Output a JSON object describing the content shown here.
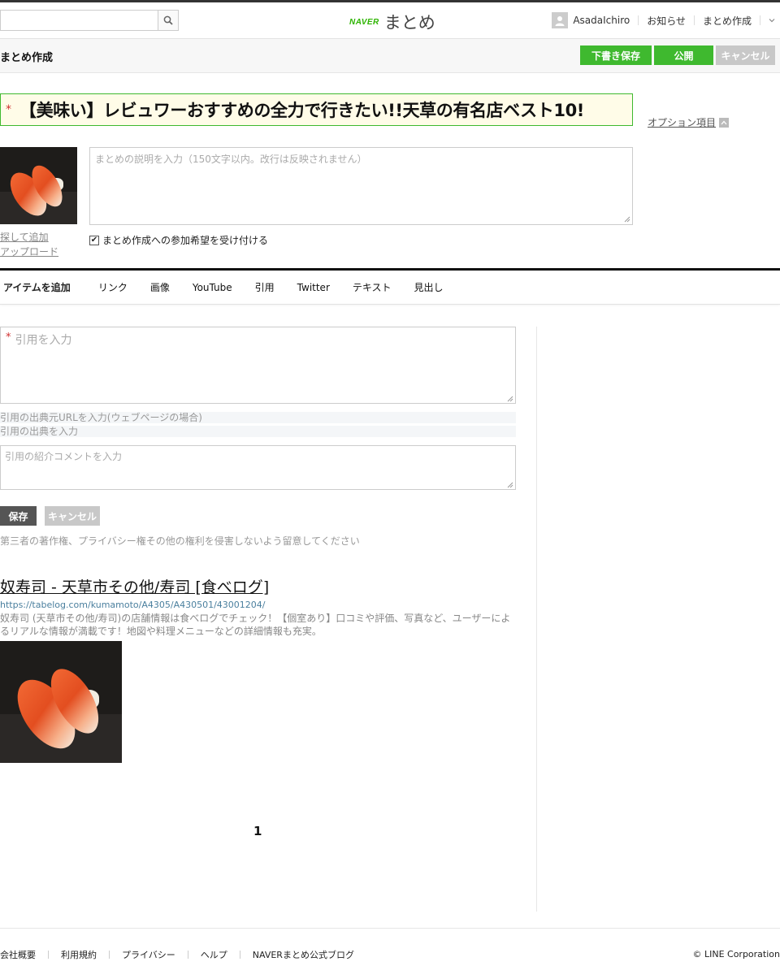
{
  "header": {
    "search": {
      "placeholder": "",
      "value": ""
    },
    "logo": {
      "brand": "NAVER",
      "product": "まとめ"
    },
    "user": {
      "name": "AsadaIchiro"
    },
    "nav": [
      "お知らせ",
      "まとめ作成"
    ]
  },
  "subheader": {
    "title": "まとめ作成",
    "buttons": {
      "draft": "下書き保存",
      "publish": "公開",
      "cancel": "キャンセル"
    }
  },
  "matome": {
    "title": "【美味い】レビュワーおすすめの全力で行きたい!!天草の有名店ベスト10!",
    "option_link": "オプション項目",
    "description_placeholder": "まとめの説明を入力（150文字以内。改行は反映されません）",
    "thumb_links": [
      "探して追加",
      "アップロード"
    ],
    "accept_participation": {
      "label": "まとめ作成への参加希望を受け付ける",
      "checked": true
    }
  },
  "item_tabs": {
    "heading": "アイテムを追加",
    "tabs": [
      "リンク",
      "画像",
      "YouTube",
      "引用",
      "Twitter",
      "テキスト",
      "見出し"
    ]
  },
  "quote_form": {
    "quote_placeholder": "引用を入力",
    "url_placeholder": "引用の出典元URLを入力(ウェブページの場合)",
    "source_placeholder": "引用の出典を入力",
    "comment_placeholder": "引用の紹介コメントを入力",
    "save": "保存",
    "cancel": "キャンセル",
    "notice": "第三者の著作権、プライバシー権その他の権利を侵害しないよう留意してください"
  },
  "link_item": {
    "title": "奴寿司 - 天草市その他/寿司 [食べログ]",
    "url": "https://tabelog.com/kumamoto/A4305/A430501/43001204/",
    "description": "奴寿司 (天草市その他/寿司)の店舗情報は食べログでチェック！【個室あり】口コミや評価、写真など、ユーザーによるリアルな情報が満載です！地図や料理メニューなどの詳細情報も充実。"
  },
  "pagination": {
    "current": "1"
  },
  "footer": {
    "links": [
      "会社概要",
      "利用規約",
      "プライバシー",
      "ヘルプ",
      "NAVERまとめ公式ブログ"
    ],
    "copyright": "© LINE Corporation"
  },
  "colors": {
    "accent_green": "#3fb92f",
    "disabled_gray": "#c8c8c8",
    "dark_button": "#555555"
  }
}
